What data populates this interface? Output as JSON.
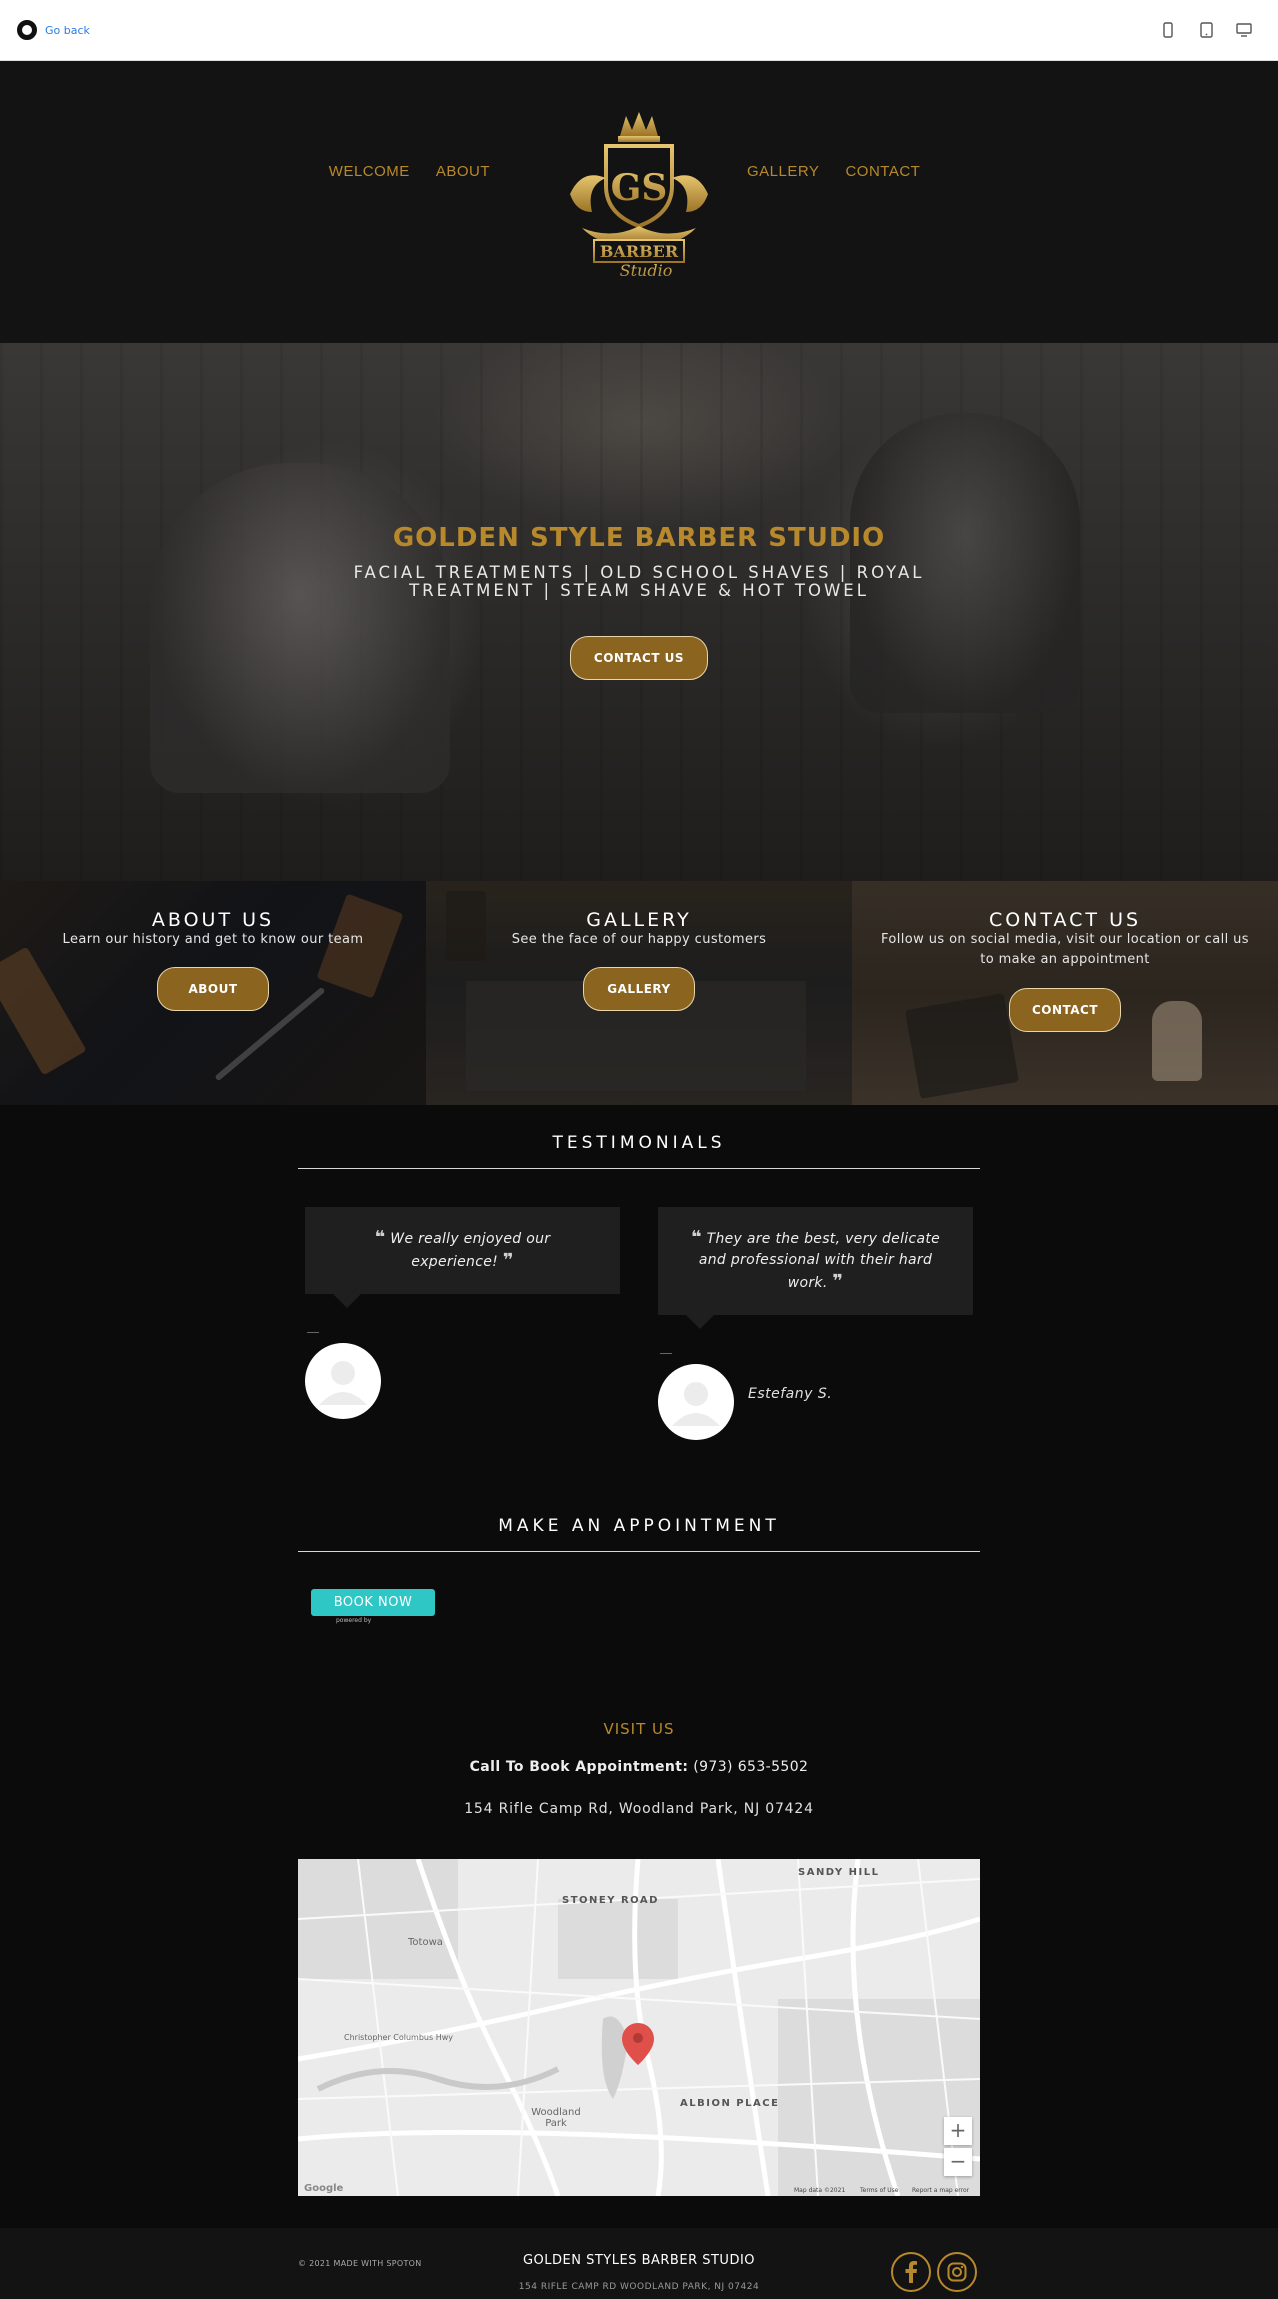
{
  "topbar": {
    "go_back": "Go back",
    "devices": [
      "phone-icon",
      "tablet-icon",
      "desktop-icon"
    ]
  },
  "nav": {
    "left": [
      "WELCOME",
      "ABOUT"
    ],
    "right": [
      "GALLERY",
      "CONTACT"
    ]
  },
  "logo": {
    "line1": "GS",
    "line2": "BARBER",
    "line3": "Studio"
  },
  "hero": {
    "title": "GOLDEN STYLE BARBER STUDIO",
    "subtitle": "FACIAL TREATMENTS | OLD SCHOOL SHAVES | ROYAL TREATMENT | STEAM SHAVE & HOT TOWEL",
    "button": "CONTACT US"
  },
  "panels": [
    {
      "title": "ABOUT US",
      "desc": "Learn our history and get to know our team",
      "button": "ABOUT"
    },
    {
      "title": "GALLERY",
      "desc": "See the face of our happy customers",
      "button": "GALLERY"
    },
    {
      "title": "CONTACT US",
      "desc": "Follow us on social media, visit our location or call us to make an appointment",
      "button": "CONTACT"
    }
  ],
  "testimonials": {
    "title": "TESTIMONIALS",
    "items": [
      {
        "quote": "We really enjoyed our experience!",
        "author": ""
      },
      {
        "quote": "They are the best, very delicate and professional with their hard work.",
        "author": "Estefany S."
      }
    ]
  },
  "appointment": {
    "title": "MAKE AN APPOINTMENT",
    "button": "BOOK NOW",
    "powered": "powered by"
  },
  "visit": {
    "title": "VISIT US",
    "call_label": "Call To Book Appointment:",
    "phone": "(973) 653-5502",
    "address": "154 Rifle Camp Rd, Woodland Park, NJ 07424"
  },
  "map": {
    "labels": {
      "sandy_hill": "SANDY HILL",
      "stoney_road": "STONEY ROAD",
      "totowa": "Totowa",
      "woodland_park": "Woodland Park",
      "albion_place": "ALBION PLACE",
      "columbus": "Christopher Columbus Hwy"
    },
    "google": "Google",
    "footer": {
      "data": "Map data ©2021",
      "terms": "Terms of Use",
      "report": "Report a map error"
    },
    "zoom_in": "+",
    "zoom_out": "−"
  },
  "footer": {
    "copyright": "© 2021 MADE WITH SPOTON",
    "title": "GOLDEN STYLES BARBER STUDIO",
    "address": "154 RIFLE CAMP RD WOODLAND PARK, NJ 07424"
  },
  "colors": {
    "gold": "#b8892c",
    "button_gold": "#8b6420",
    "teal": "#2fc6c6"
  }
}
